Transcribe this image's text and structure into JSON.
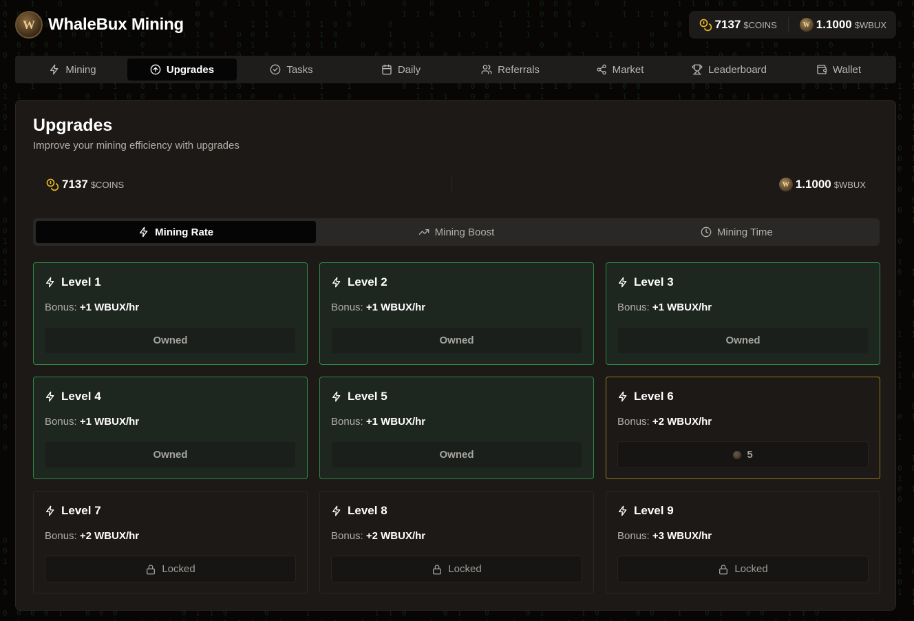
{
  "app": {
    "title": "WhaleBux Mining",
    "logo_letter": "W"
  },
  "header_balances": {
    "coins": {
      "amount": "7137",
      "unit": "$COINS"
    },
    "wbux": {
      "amount": "1.1000",
      "unit": "$WBUX"
    }
  },
  "nav": {
    "items": [
      {
        "label": "Mining",
        "icon": "bolt-icon",
        "active": false
      },
      {
        "label": "Upgrades",
        "icon": "arrow-up-circle-icon",
        "active": true
      },
      {
        "label": "Tasks",
        "icon": "check-circle-icon",
        "active": false
      },
      {
        "label": "Daily",
        "icon": "calendar-icon",
        "active": false
      },
      {
        "label": "Referrals",
        "icon": "users-icon",
        "active": false
      },
      {
        "label": "Market",
        "icon": "share-icon",
        "active": false
      },
      {
        "label": "Leaderboard",
        "icon": "trophy-icon",
        "active": false
      },
      {
        "label": "Wallet",
        "icon": "wallet-icon",
        "active": false
      }
    ]
  },
  "panel": {
    "title": "Upgrades",
    "subtitle": "Improve your mining efficiency with upgrades",
    "coins": {
      "amount": "7137",
      "unit": "$COINS"
    },
    "wbux": {
      "amount": "1.1000",
      "unit": "$WBUX"
    }
  },
  "tabs": [
    {
      "label": "Mining Rate",
      "icon": "bolt-icon",
      "active": true
    },
    {
      "label": "Mining Boost",
      "icon": "trending-up-icon",
      "active": false
    },
    {
      "label": "Mining Time",
      "icon": "clock-icon",
      "active": false
    }
  ],
  "bonus_prefix": "Bonus:",
  "levels": [
    {
      "title": "Level 1",
      "bonus": "+1 WBUX/hr",
      "status": "owned",
      "button": "Owned"
    },
    {
      "title": "Level 2",
      "bonus": "+1 WBUX/hr",
      "status": "owned",
      "button": "Owned"
    },
    {
      "title": "Level 3",
      "bonus": "+1 WBUX/hr",
      "status": "owned",
      "button": "Owned"
    },
    {
      "title": "Level 4",
      "bonus": "+1 WBUX/hr",
      "status": "owned",
      "button": "Owned"
    },
    {
      "title": "Level 5",
      "bonus": "+1 WBUX/hr",
      "status": "owned",
      "button": "Owned"
    },
    {
      "title": "Level 6",
      "bonus": "+2 WBUX/hr",
      "status": "available",
      "button": "5"
    },
    {
      "title": "Level 7",
      "bonus": "+2 WBUX/hr",
      "status": "locked",
      "button": "Locked"
    },
    {
      "title": "Level 8",
      "bonus": "+2 WBUX/hr",
      "status": "locked",
      "button": "Locked"
    },
    {
      "title": "Level 9",
      "bonus": "+3 WBUX/hr",
      "status": "locked",
      "button": "Locked"
    }
  ],
  "colors": {
    "owned_border": "#2f8a45",
    "available_border": "#9a7a1e",
    "coin_gold": "#e8b923"
  }
}
